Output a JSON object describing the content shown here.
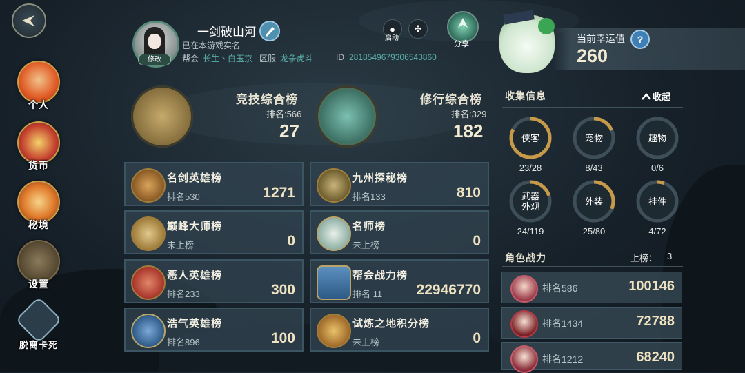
{
  "nav": {
    "back_icon": "back-arrow-icon"
  },
  "sidebar": {
    "items": [
      {
        "label": "个人",
        "icon": "person-icon"
      },
      {
        "label": "货币",
        "icon": "treasure-icon"
      },
      {
        "label": "秘境",
        "icon": "dragon-mask-icon"
      },
      {
        "label": "设置",
        "icon": "gear-icon"
      },
      {
        "label": "脱离卡死",
        "icon": "unstuck-gear-icon"
      }
    ]
  },
  "profile": {
    "name": "一剑破山河",
    "edit_label": "修改",
    "realname_status": "已在本游戏实名",
    "guild_label": "帮会",
    "guild_value": "长生丶白玉京",
    "server_label": "区服",
    "server_value": "龙争虎斗",
    "id_label": "ID",
    "id_value": "2818549679306543860"
  },
  "top_actions": {
    "launch_label": "启动",
    "share_label": "分享"
  },
  "luck": {
    "label": "当前幸运值",
    "value": "260",
    "help": "?"
  },
  "big_ranks": [
    {
      "title": "竞技综合榜",
      "rank_text": "排名:566",
      "value": "27"
    },
    {
      "title": "修行综合榜",
      "rank_text": "排名:329",
      "value": "182"
    }
  ],
  "rank_cards": [
    {
      "title": "名剑英雄榜",
      "rank": "排名530",
      "value": "1271"
    },
    {
      "title": "九州探秘榜",
      "rank": "排名133",
      "value": "810"
    },
    {
      "title": "巅峰大师榜",
      "rank": "未上榜",
      "value": "0"
    },
    {
      "title": "名师榜",
      "rank": "未上榜",
      "value": "0"
    },
    {
      "title": "恶人英雄榜",
      "rank": "排名233",
      "value": "300"
    },
    {
      "title": "帮会战力榜",
      "rank": "排名 11",
      "value": "22946770"
    },
    {
      "title": "浩气英雄榜",
      "rank": "排名896",
      "value": "100"
    },
    {
      "title": "试炼之地积分榜",
      "rank": "未上榜",
      "value": "0"
    }
  ],
  "collect": {
    "title": "收集信息",
    "collapse_label": "收起",
    "items": [
      {
        "label": "侠客",
        "count": "23/28",
        "current": 23,
        "total": 28
      },
      {
        "label": "宠物",
        "count": "8/43",
        "current": 8,
        "total": 43
      },
      {
        "label": "趣物",
        "count": "0/6",
        "current": 0,
        "total": 6
      },
      {
        "label": "武器\n外观",
        "count": "24/119",
        "current": 24,
        "total": 119
      },
      {
        "label": "外装",
        "count": "25/80",
        "current": 25,
        "total": 80
      },
      {
        "label": "挂件",
        "count": "4/72",
        "current": 4,
        "total": 72
      }
    ]
  },
  "power": {
    "title": "角色战力",
    "onboard_label": "上榜：",
    "onboard_count": "3",
    "rows": [
      {
        "rank": "排名586",
        "value": "100146"
      },
      {
        "rank": "排名1434",
        "value": "72788"
      },
      {
        "rank": "排名1212",
        "value": "68240"
      }
    ]
  }
}
